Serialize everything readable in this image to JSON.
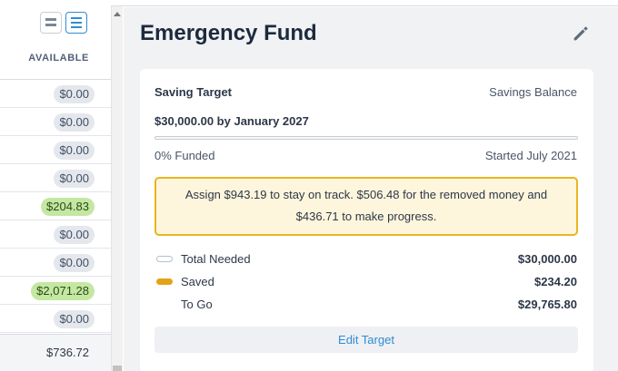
{
  "table": {
    "available_header": "AVAILABLE",
    "rows": [
      {
        "value": "$0.00",
        "positive": false
      },
      {
        "value": "$0.00",
        "positive": false
      },
      {
        "value": "$0.00",
        "positive": false
      },
      {
        "value": "$0.00",
        "positive": false
      },
      {
        "value": "$204.83",
        "positive": true
      },
      {
        "value": "$0.00",
        "positive": false
      },
      {
        "value": "$0.00",
        "positive": false
      },
      {
        "value": "$2,071.28",
        "positive": true
      },
      {
        "value": "$0.00",
        "positive": false
      }
    ],
    "total": "$736.72"
  },
  "inspector": {
    "title": "Emergency Fund",
    "saving_target_label": "Saving Target",
    "savings_balance_label": "Savings Balance",
    "target_summary": "$30,000.00 by January 2027",
    "progress_fraction": 0.0,
    "funded_text": "0% Funded",
    "started_text": "Started July 2021",
    "alert_line1": "Assign $943.19 to stay on track. $506.48 for the removed money and",
    "alert_line2": "$436.71 to make progress.",
    "legend": {
      "total_needed_label": "Total Needed",
      "total_needed_value": "$30,000.00",
      "saved_label": "Saved",
      "saved_value": "$234.20",
      "to_go_label": "To Go",
      "to_go_value": "$29,765.80"
    },
    "edit_target_label": "Edit Target"
  },
  "colors": {
    "accent": "#2f8cd3",
    "saved": "#e3a317",
    "positive_pill": "#c4e7a2",
    "alert_bg": "#fef6dc"
  }
}
